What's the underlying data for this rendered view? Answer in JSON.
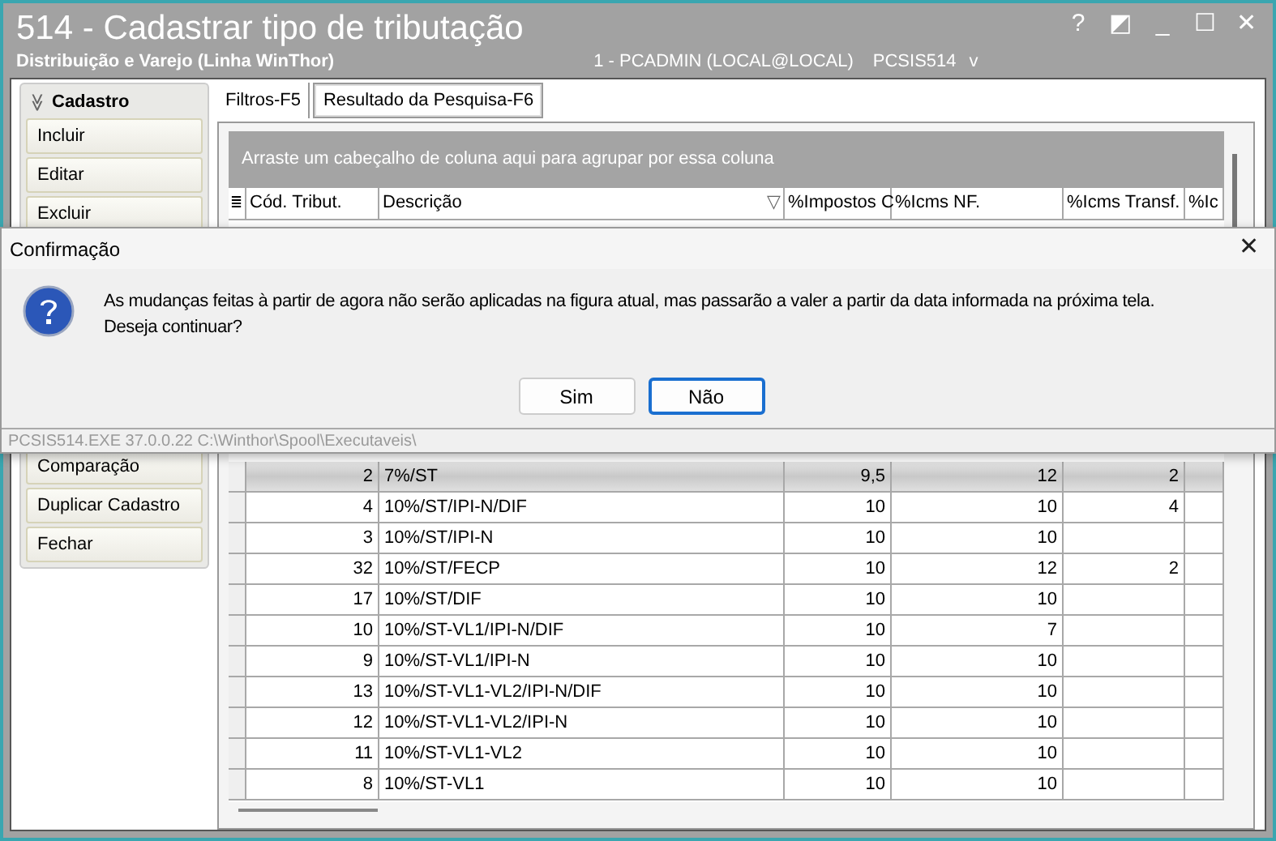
{
  "window": {
    "title": "514 - Cadastrar tipo de tributação",
    "subtitle": "Distribuição e Varejo (Linha WinThor)",
    "session": "1 - PCADMIN (LOCAL@LOCAL)",
    "program": "PCSIS514",
    "version": "v",
    "controls": [
      "?",
      "◩",
      "_",
      "☐",
      "✕"
    ]
  },
  "sidebar": {
    "title": "Cadastro",
    "expand_glyph": "≫",
    "items_top": [
      "Incluir",
      "Editar",
      "Excluir"
    ],
    "items_bottom": [
      "Comparação",
      "Duplicar Cadastro",
      "Fechar"
    ]
  },
  "tabs": [
    {
      "label": "Filtros-F5",
      "selected": false
    },
    {
      "label": "Resultado da Pesquisa-F6",
      "selected": true
    }
  ],
  "grid": {
    "group_hint": "Arraste um cabeçalho de coluna aqui para agrupar por essa coluna",
    "chooser_glyph": "≣",
    "filter_glyph": "▽",
    "columns": [
      "Cód. Tribut.",
      "Descrição",
      "%Impostos C",
      "%Icms NF.",
      "%Icms Transf.",
      "%Ic"
    ],
    "rows": [
      {
        "cells": [
          "2",
          "7%/ST",
          "9,5",
          "12",
          "2",
          ""
        ],
        "selected": true
      },
      {
        "cells": [
          "4",
          "10%/ST/IPI-N/DIF",
          "10",
          "10",
          "4",
          ""
        ],
        "selected": false
      },
      {
        "cells": [
          "3",
          "10%/ST/IPI-N",
          "10",
          "10",
          "",
          ""
        ],
        "selected": false
      },
      {
        "cells": [
          "32",
          "10%/ST/FECP",
          "10",
          "12",
          "2",
          ""
        ],
        "selected": false
      },
      {
        "cells": [
          "17",
          "10%/ST/DIF",
          "10",
          "10",
          "",
          ""
        ],
        "selected": false
      },
      {
        "cells": [
          "10",
          "10%/ST-VL1/IPI-N/DIF",
          "10",
          "7",
          "",
          ""
        ],
        "selected": false
      },
      {
        "cells": [
          "9",
          "10%/ST-VL1/IPI-N",
          "10",
          "10",
          "",
          ""
        ],
        "selected": false
      },
      {
        "cells": [
          "13",
          "10%/ST-VL1-VL2/IPI-N/DIF",
          "10",
          "10",
          "",
          ""
        ],
        "selected": false
      },
      {
        "cells": [
          "12",
          "10%/ST-VL1-VL2/IPI-N",
          "10",
          "10",
          "",
          ""
        ],
        "selected": false
      },
      {
        "cells": [
          "11",
          "10%/ST-VL1-VL2",
          "10",
          "10",
          "",
          ""
        ],
        "selected": false
      },
      {
        "cells": [
          "8",
          "10%/ST-VL1",
          "10",
          "10",
          "",
          ""
        ],
        "selected": false
      }
    ]
  },
  "dialog": {
    "title": "Confirmação",
    "close_glyph": "✕",
    "message": "As mudanças feitas à partir de agora não serão aplicadas na figura atual, mas passarão a valer a partir da data informada na próxima tela.",
    "question": "Deseja continuar?",
    "buttons": [
      {
        "label": "Sim",
        "selected": false
      },
      {
        "label": "Não",
        "selected": true
      }
    ],
    "status": "PCSIS514.EXE 37.0.0.22 C:\\Winthor\\Spool\\Executaveis\\"
  }
}
